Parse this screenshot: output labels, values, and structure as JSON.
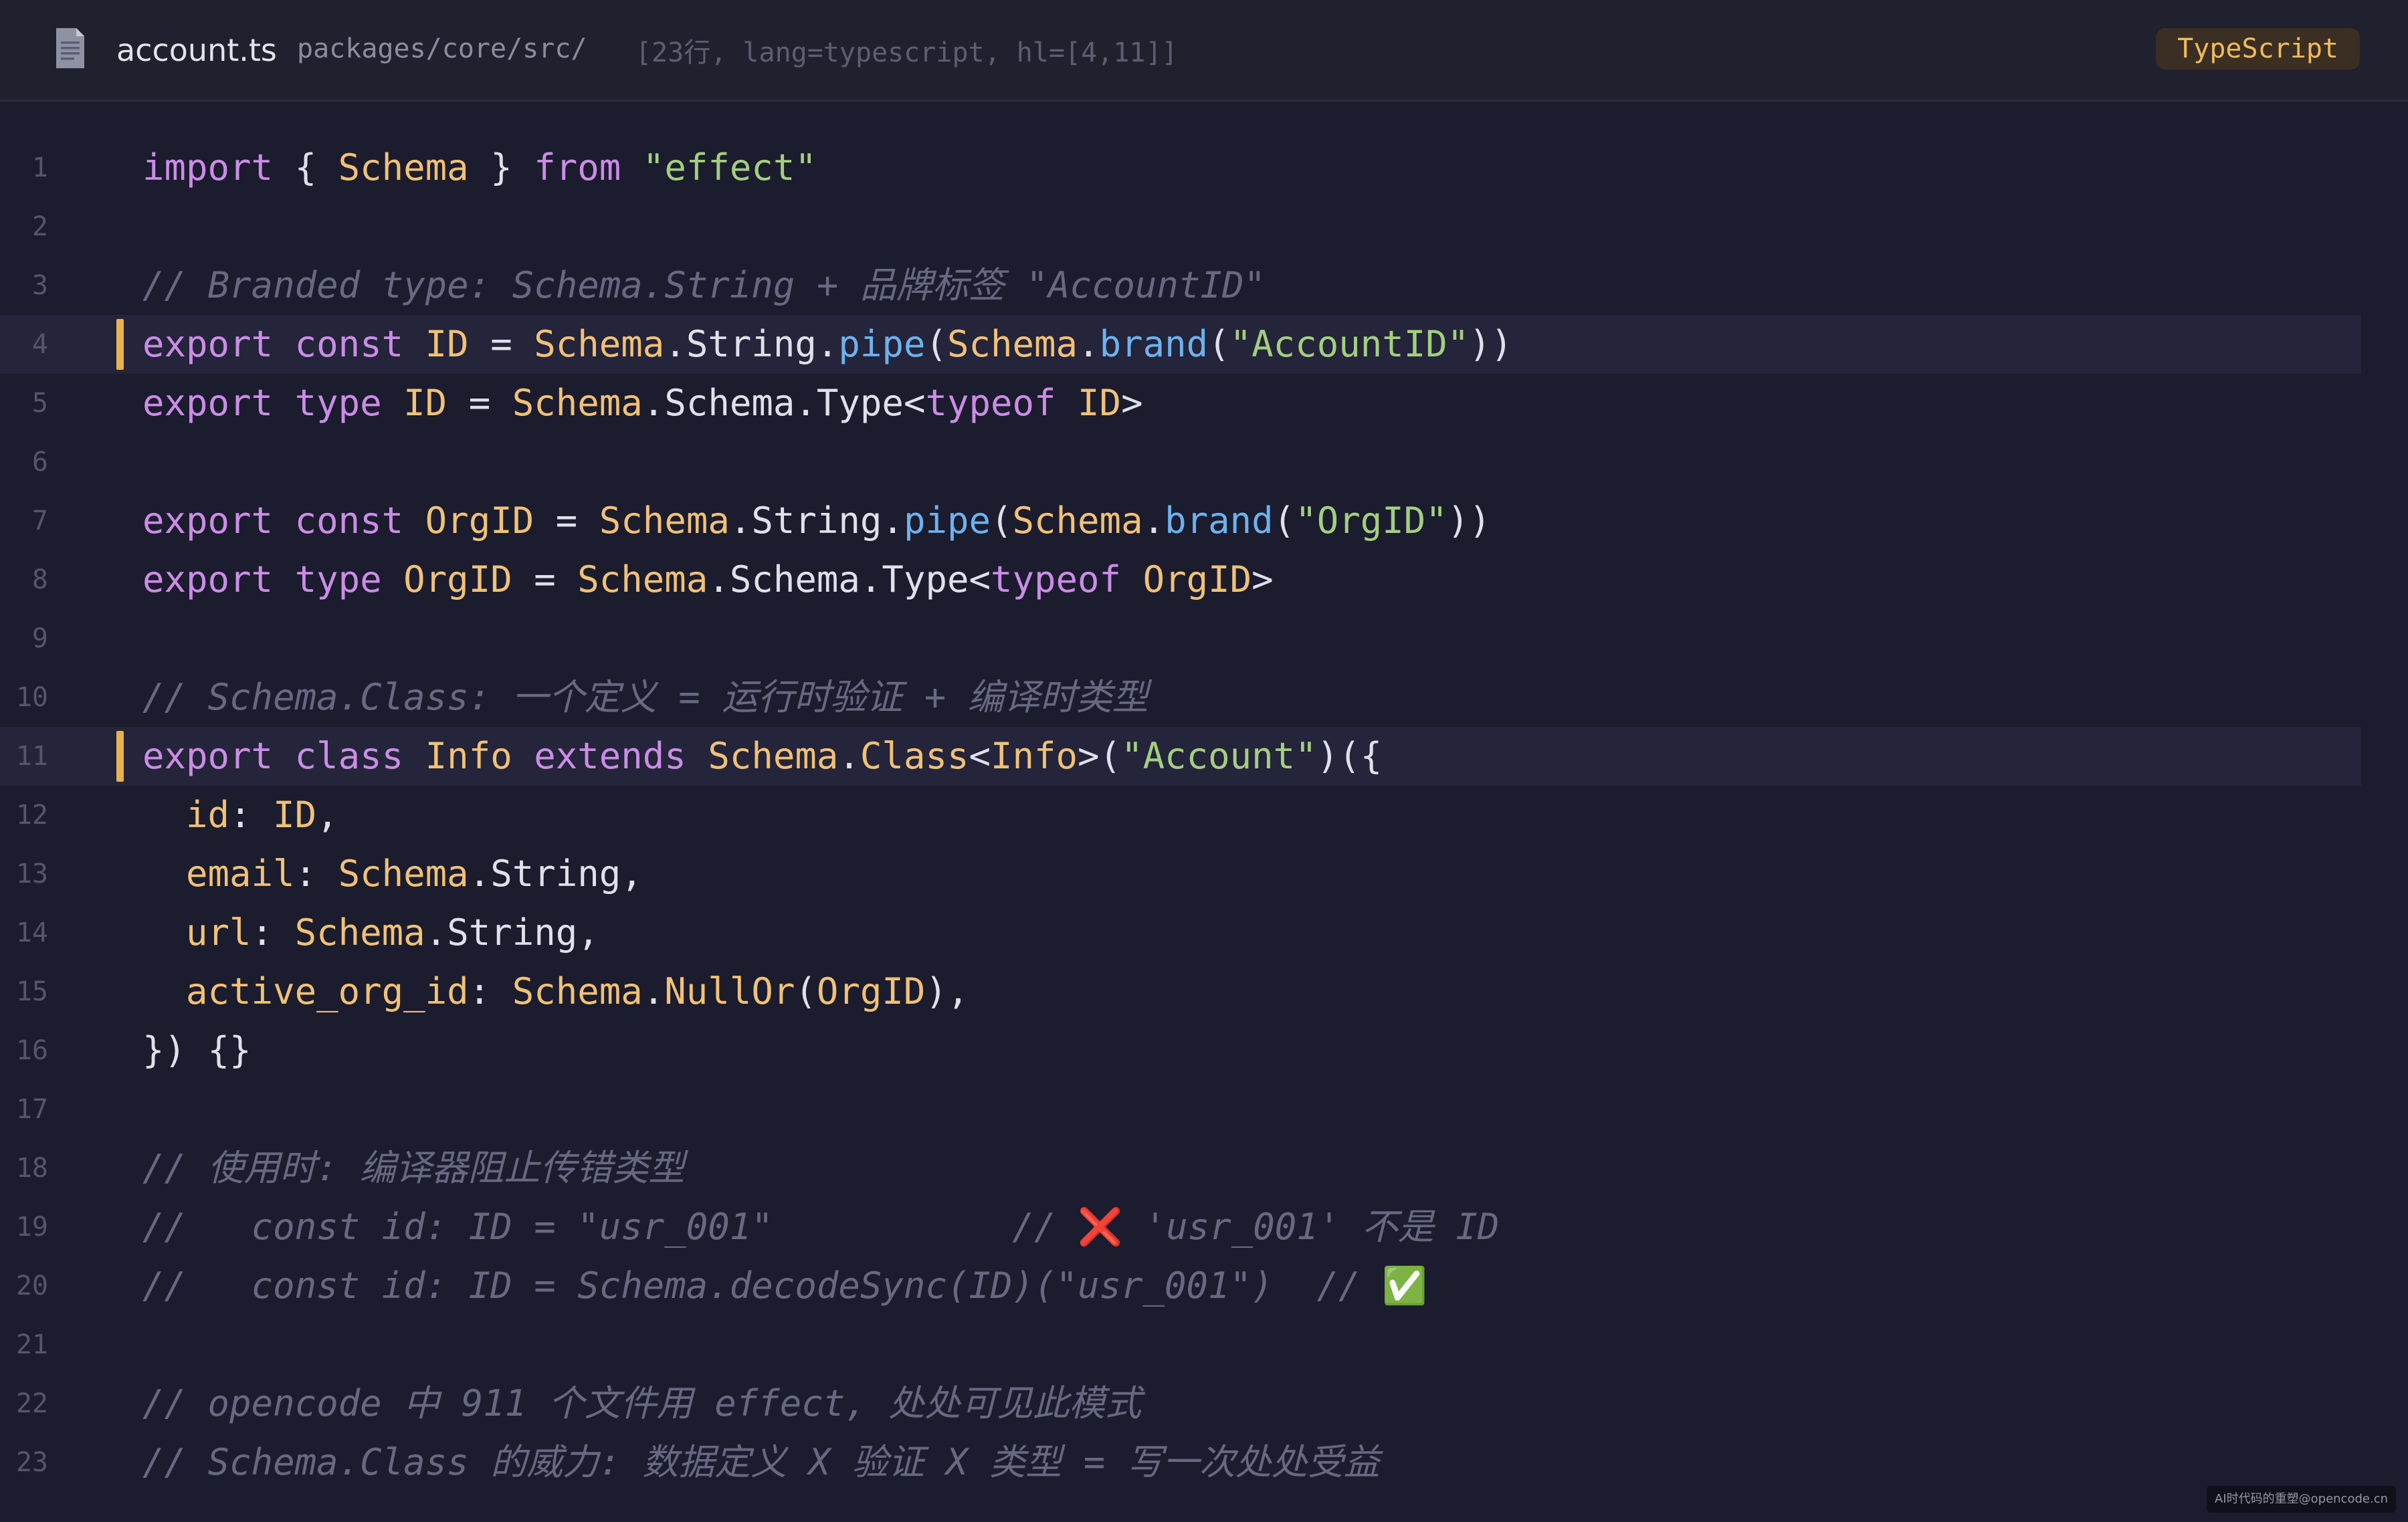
{
  "header": {
    "filename": "account.ts",
    "path": "packages/core/src/",
    "meta": "[23行, lang=typescript, hl=[4,11]]",
    "language": "TypeScript",
    "icon": "document-icon"
  },
  "code": {
    "highlighted_lines": [
      4,
      11
    ],
    "lines": [
      {
        "n": "1",
        "tokens": [
          [
            "kw",
            "import"
          ],
          [
            "pl",
            " { "
          ],
          [
            "ty",
            "Schema"
          ],
          [
            "pl",
            " } "
          ],
          [
            "kw",
            "from"
          ],
          [
            "pl",
            " "
          ],
          [
            "st",
            "\"effect\""
          ]
        ]
      },
      {
        "n": "2",
        "tokens": []
      },
      {
        "n": "3",
        "tokens": [
          [
            "cm",
            "// Branded type: Schema.String + 品牌标签 \"AccountID\""
          ]
        ]
      },
      {
        "n": "4",
        "tokens": [
          [
            "kw",
            "export"
          ],
          [
            "pl",
            " "
          ],
          [
            "kw",
            "const"
          ],
          [
            "pl",
            " "
          ],
          [
            "ty",
            "ID"
          ],
          [
            "pl",
            " = "
          ],
          [
            "ty",
            "Schema"
          ],
          [
            "pl",
            ".String."
          ],
          [
            "fn",
            "pipe"
          ],
          [
            "pl",
            "("
          ],
          [
            "ty",
            "Schema"
          ],
          [
            "pl",
            "."
          ],
          [
            "fn",
            "brand"
          ],
          [
            "pl",
            "("
          ],
          [
            "st",
            "\"AccountID\""
          ],
          [
            "pl",
            "))"
          ]
        ]
      },
      {
        "n": "5",
        "tokens": [
          [
            "kw",
            "export"
          ],
          [
            "pl",
            " "
          ],
          [
            "kw",
            "type"
          ],
          [
            "pl",
            " "
          ],
          [
            "ty",
            "ID"
          ],
          [
            "pl",
            " = "
          ],
          [
            "ty",
            "Schema"
          ],
          [
            "pl",
            ".Schema.Type<"
          ],
          [
            "kw",
            "typeof"
          ],
          [
            "pl",
            " "
          ],
          [
            "ty",
            "ID"
          ],
          [
            "pl",
            ">"
          ]
        ]
      },
      {
        "n": "6",
        "tokens": []
      },
      {
        "n": "7",
        "tokens": [
          [
            "kw",
            "export"
          ],
          [
            "pl",
            " "
          ],
          [
            "kw",
            "const"
          ],
          [
            "pl",
            " "
          ],
          [
            "ty",
            "OrgID"
          ],
          [
            "pl",
            " = "
          ],
          [
            "ty",
            "Schema"
          ],
          [
            "pl",
            ".String."
          ],
          [
            "fn",
            "pipe"
          ],
          [
            "pl",
            "("
          ],
          [
            "ty",
            "Schema"
          ],
          [
            "pl",
            "."
          ],
          [
            "fn",
            "brand"
          ],
          [
            "pl",
            "("
          ],
          [
            "st",
            "\"OrgID\""
          ],
          [
            "pl",
            "))"
          ]
        ]
      },
      {
        "n": "8",
        "tokens": [
          [
            "kw",
            "export"
          ],
          [
            "pl",
            " "
          ],
          [
            "kw",
            "type"
          ],
          [
            "pl",
            " "
          ],
          [
            "ty",
            "OrgID"
          ],
          [
            "pl",
            " = "
          ],
          [
            "ty",
            "Schema"
          ],
          [
            "pl",
            ".Schema.Type<"
          ],
          [
            "kw",
            "typeof"
          ],
          [
            "pl",
            " "
          ],
          [
            "ty",
            "OrgID"
          ],
          [
            "pl",
            ">"
          ]
        ]
      },
      {
        "n": "9",
        "tokens": []
      },
      {
        "n": "10",
        "tokens": [
          [
            "cm",
            "// Schema.Class: 一个定义 = 运行时验证 + 编译时类型"
          ]
        ]
      },
      {
        "n": "11",
        "tokens": [
          [
            "kw",
            "export"
          ],
          [
            "pl",
            " "
          ],
          [
            "kw",
            "class"
          ],
          [
            "pl",
            " "
          ],
          [
            "ty",
            "Info"
          ],
          [
            "pl",
            " "
          ],
          [
            "kw",
            "extends"
          ],
          [
            "pl",
            " "
          ],
          [
            "ty",
            "Schema"
          ],
          [
            "pl",
            "."
          ],
          [
            "ty",
            "Class"
          ],
          [
            "pl",
            "<"
          ],
          [
            "ty",
            "Info"
          ],
          [
            "pl",
            ">("
          ],
          [
            "st",
            "\"Account\""
          ],
          [
            "pl",
            ")({"
          ]
        ]
      },
      {
        "n": "12",
        "tokens": [
          [
            "pl",
            "  "
          ],
          [
            "ty",
            "id"
          ],
          [
            "pl",
            ": "
          ],
          [
            "ty",
            "ID"
          ],
          [
            "pl",
            ","
          ]
        ]
      },
      {
        "n": "13",
        "tokens": [
          [
            "pl",
            "  "
          ],
          [
            "ty",
            "email"
          ],
          [
            "pl",
            ": "
          ],
          [
            "ty",
            "Schema"
          ],
          [
            "pl",
            ".String,"
          ]
        ]
      },
      {
        "n": "14",
        "tokens": [
          [
            "pl",
            "  "
          ],
          [
            "ty",
            "url"
          ],
          [
            "pl",
            ": "
          ],
          [
            "ty",
            "Schema"
          ],
          [
            "pl",
            ".String,"
          ]
        ]
      },
      {
        "n": "15",
        "tokens": [
          [
            "pl",
            "  "
          ],
          [
            "ty",
            "active_org_id"
          ],
          [
            "pl",
            ": "
          ],
          [
            "ty",
            "Schema"
          ],
          [
            "pl",
            "."
          ],
          [
            "ty",
            "NullOr"
          ],
          [
            "pl",
            "("
          ],
          [
            "ty",
            "OrgID"
          ],
          [
            "pl",
            "),"
          ]
        ]
      },
      {
        "n": "16",
        "tokens": [
          [
            "pl",
            "}) {}"
          ]
        ]
      },
      {
        "n": "17",
        "tokens": []
      },
      {
        "n": "18",
        "tokens": [
          [
            "cm",
            "// 使用时: 编译器阻止传错类型"
          ]
        ]
      },
      {
        "n": "19",
        "tokens": [
          [
            "cm",
            "//   const id: ID = \"usr_001\"           // "
          ],
          [
            "emo",
            "❌"
          ],
          [
            "cm",
            " 'usr_001' 不是 ID"
          ]
        ]
      },
      {
        "n": "20",
        "tokens": [
          [
            "cm",
            "//   const id: ID = Schema.decodeSync(ID)(\"usr_001\")  // "
          ],
          [
            "emo",
            "✅"
          ]
        ]
      },
      {
        "n": "21",
        "tokens": []
      },
      {
        "n": "22",
        "tokens": [
          [
            "cm",
            "// opencode 中 911 个文件用 effect, 处处可见此模式"
          ]
        ]
      },
      {
        "n": "23",
        "tokens": [
          [
            "cm",
            "// Schema.Class 的威力: 数据定义 X 验证 X 类型 = 写一次处处受益"
          ]
        ]
      }
    ]
  },
  "watermark": "AI时代码的重塑@opencode.cn",
  "colors": {
    "background": "#1b1c2e",
    "keyword": "#cc8ce6",
    "type": "#f1c175",
    "function": "#6cb2ef",
    "string": "#a3cf7f",
    "comment": "#666980",
    "highlight_bar": "#e9b34a"
  }
}
